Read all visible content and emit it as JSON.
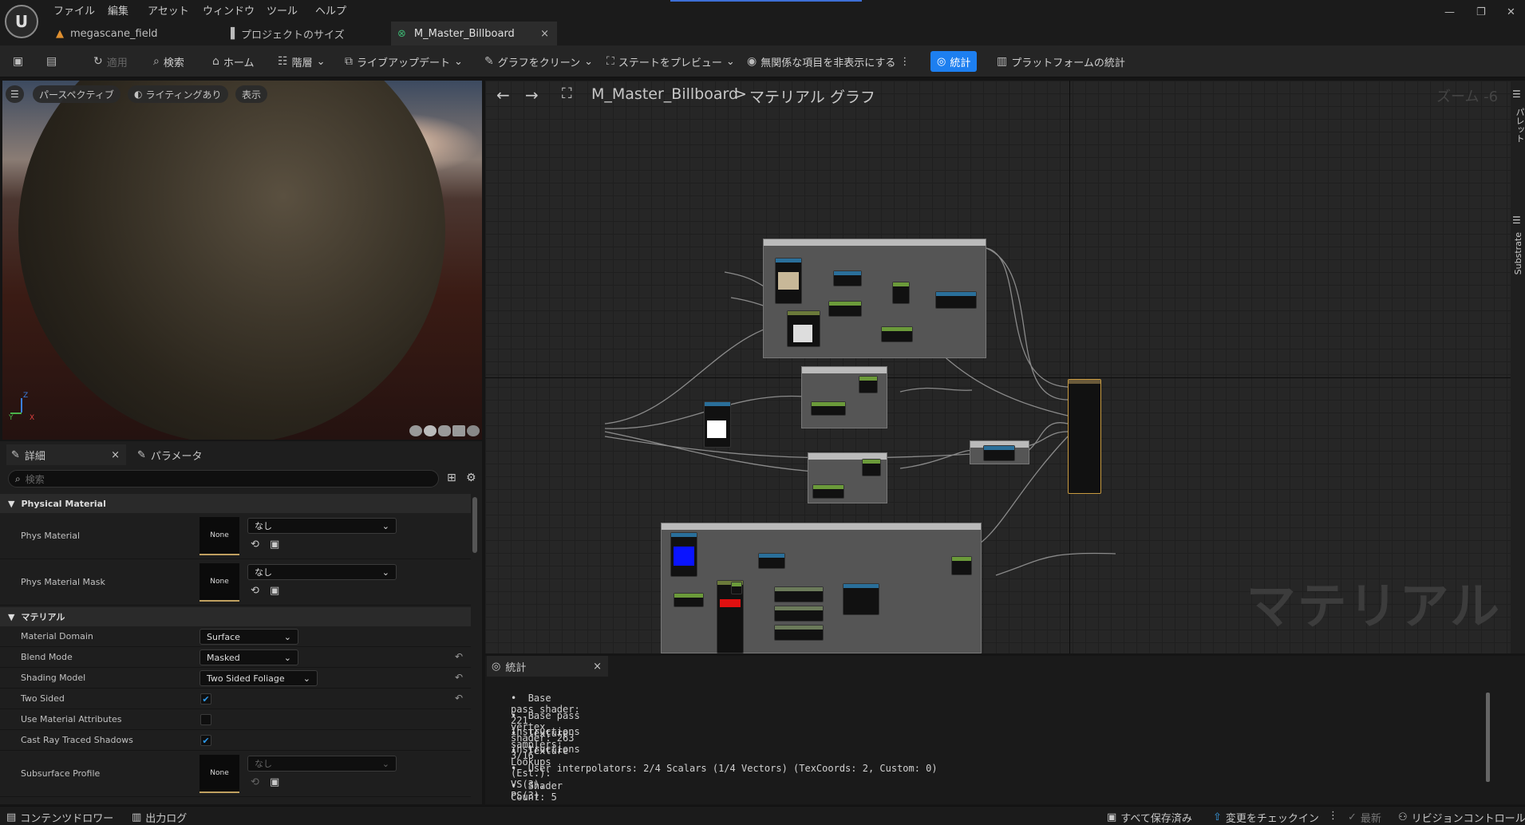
{
  "menu": [
    "ファイル",
    "編集",
    "アセット",
    "ウィンドウ",
    "ツール",
    "ヘルプ"
  ],
  "tabs": [
    {
      "label": "megascane_field"
    },
    {
      "label": "プロジェクトのサイズ"
    },
    {
      "label": "M_Master_Billboard",
      "close": "×"
    }
  ],
  "window_controls": {
    "minimize": "—",
    "restore": "❐",
    "close": "✕"
  },
  "toolbar": {
    "apply": "適用",
    "search": "検索",
    "home": "ホーム",
    "hierarchy": "階層",
    "live_update": "ライブアップデート",
    "clean_graph": "グラフをクリーン",
    "preview_state": "ステートをプレビュー",
    "hide_unrelated": "無関係な項目を非表示にする",
    "stats": "統計",
    "platform_stats": "プラットフォームの統計"
  },
  "viewport": {
    "perspective": "パースペクティブ",
    "lighting": "ライティングあり",
    "show": "表示",
    "axis_y": "Y",
    "axis_z": "Z",
    "axis_x": "X"
  },
  "details": {
    "tab_details": "詳細",
    "tab_close": "×",
    "tab_params": "パラメータ",
    "search_placeholder": "検索",
    "section_physical": "Physical Material",
    "phys_material": "Phys Material",
    "phys_material_mask": "Phys Material Mask",
    "none_thumb": "None",
    "none_value": "なし",
    "section_material": "マテリアル",
    "material_domain_label": "Material Domain",
    "material_domain_value": "Surface",
    "blend_mode_label": "Blend Mode",
    "blend_mode_value": "Masked",
    "shading_model_label": "Shading Model",
    "shading_model_value": "Two Sided Foliage",
    "two_sided_label": "Two Sided",
    "two_sided_checked": true,
    "use_material_attributes_label": "Use Material Attributes",
    "use_material_attributes_checked": false,
    "cast_ray_label": "Cast Ray Traced Shadows",
    "cast_ray_checked": true,
    "subsurface_label": "Subsurface Profile"
  },
  "graph": {
    "asset": "M_Master_Billboard",
    "separator": ">",
    "graph_label": "マテリアル グラフ",
    "zoom": "ズーム -6",
    "watermark": "マテリアル",
    "side_palette": "パレット",
    "side_substrate": "Substrate"
  },
  "stats_panel": {
    "tab": "統計",
    "close": "×",
    "lines": [
      "Base pass shader: 221 instructions",
      "Base pass vertex shader: 263 instructions",
      "Texture samplers: 3/16",
      "Texture Lookups (Est.): VS(3), PS(3)",
      "User interpolators: 2/4 Scalars (1/4 Vectors) (TexCoords: 2, Custom: 0)",
      "Shader Count: 5"
    ]
  },
  "statusbar": {
    "content_drawer": "コンテンツドロワー",
    "output_log": "出力ログ",
    "all_saved": "すべて保存済み",
    "check_changes": "変更をチェックイン",
    "latest": "最新",
    "revision_control": "リビジョンコントロール"
  }
}
